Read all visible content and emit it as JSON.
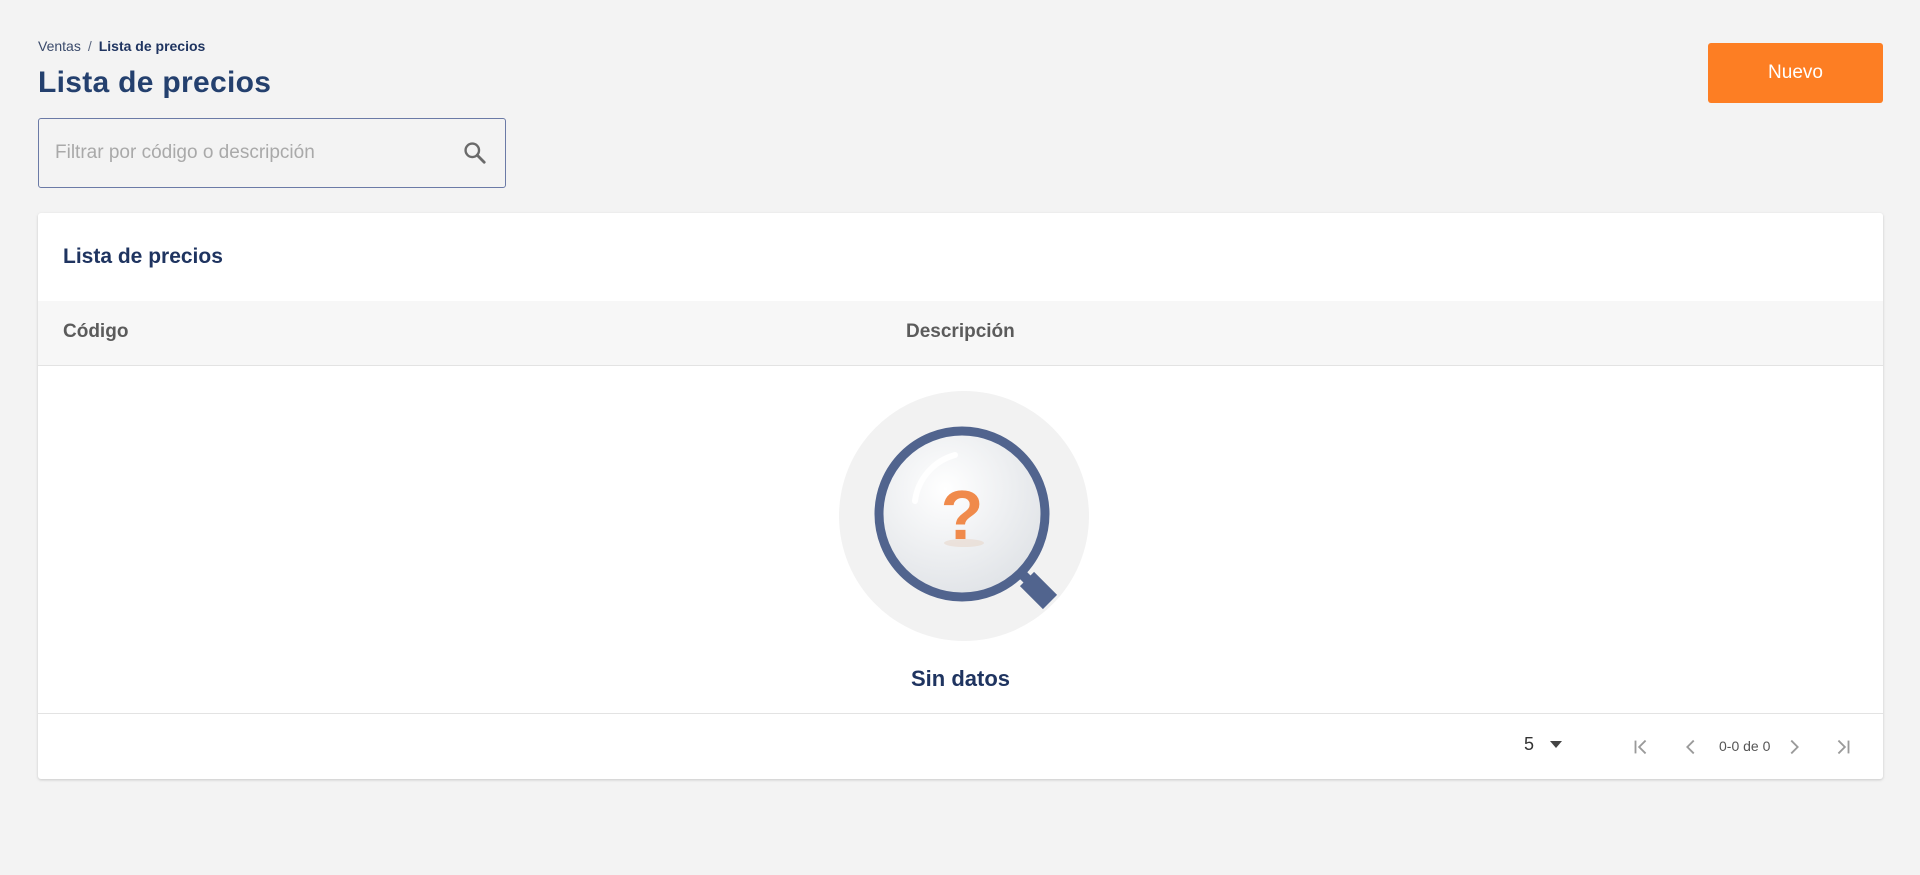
{
  "breadcrumb": {
    "parent": "Ventas",
    "separator": "/",
    "current": "Lista de precios"
  },
  "page": {
    "title": "Lista de precios"
  },
  "toolbar": {
    "new_label": "Nuevo"
  },
  "search": {
    "placeholder": "Filtrar por código o descripción",
    "value": "",
    "icon": "search-icon"
  },
  "table": {
    "title": "Lista de precios",
    "columns": [
      "Código",
      "Descripción"
    ],
    "rows": [],
    "empty_text": "Sin datos",
    "empty_icon": "magnifier-question-icon"
  },
  "pagination": {
    "page_size": "5",
    "range": "0-0 de 0",
    "icons": [
      "first-page-icon",
      "prev-page-icon",
      "next-page-icon",
      "last-page-icon"
    ]
  },
  "colors": {
    "accent": "#fd7e23",
    "title": "#24406e",
    "background": "#f3f3f3",
    "illustration": "#51648e",
    "question": "#f08a4b"
  }
}
